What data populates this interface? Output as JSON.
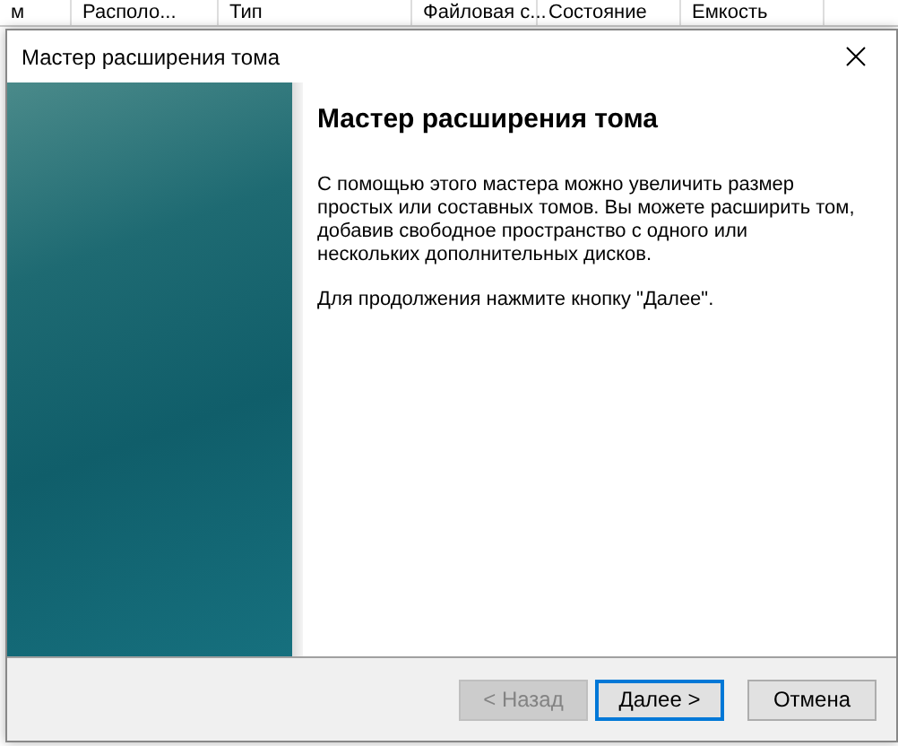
{
  "background_table": {
    "columns": [
      "м",
      "Располо...",
      "Тип",
      "Файловая с...",
      "Состояние",
      "Емкость"
    ]
  },
  "window": {
    "title": "Мастер расширения тома"
  },
  "page": {
    "heading": "Мастер расширения тома",
    "paragraphs": [
      "С помощью этого мастера можно увеличить размер простых или составных томов. Вы можете расширить том, добавив свободное пространство с одного или нескольких дополнительных дисков.",
      "Для продолжения нажмите кнопку \"Далее\"."
    ]
  },
  "buttons": [
    {
      "label": "< Назад",
      "disabled": true,
      "default": false
    },
    {
      "label": "Далее >",
      "disabled": false,
      "default": true
    },
    {
      "label": "Отмена",
      "disabled": false,
      "default": false
    }
  ]
}
